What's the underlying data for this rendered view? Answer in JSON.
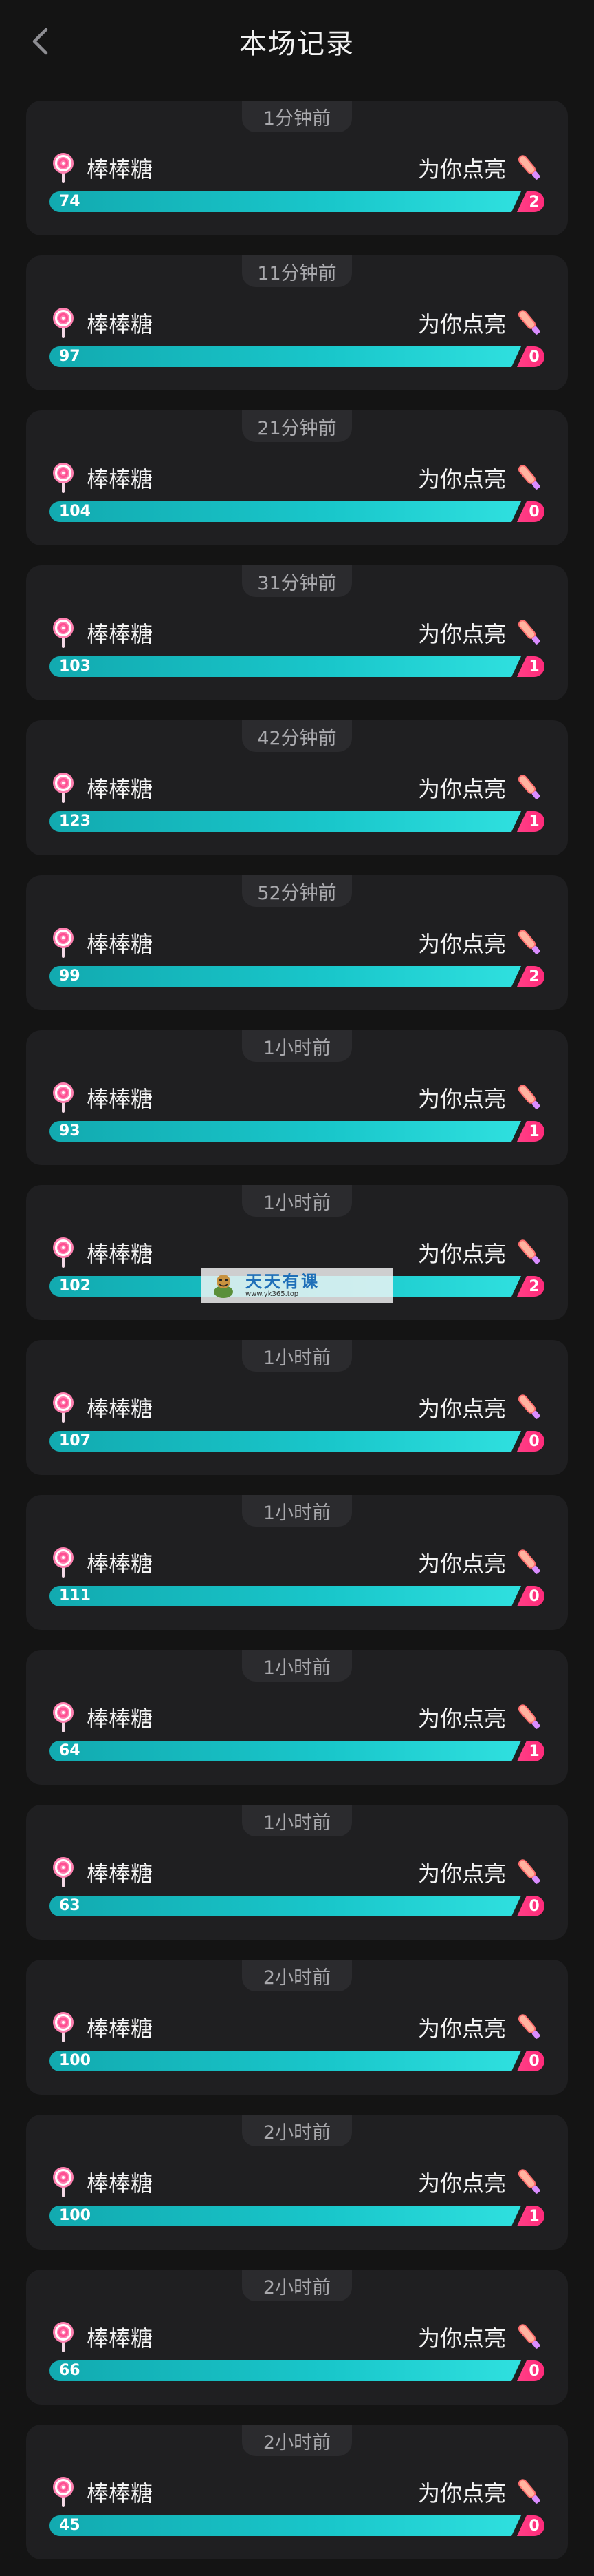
{
  "header": {
    "title": "本场记录"
  },
  "records": [
    {
      "time": "1分钟前",
      "gift": "棒棒糖",
      "cheer": "为你点亮",
      "value": "74",
      "count": "2"
    },
    {
      "time": "11分钟前",
      "gift": "棒棒糖",
      "cheer": "为你点亮",
      "value": "97",
      "count": "0"
    },
    {
      "time": "21分钟前",
      "gift": "棒棒糖",
      "cheer": "为你点亮",
      "value": "104",
      "count": "0"
    },
    {
      "time": "31分钟前",
      "gift": "棒棒糖",
      "cheer": "为你点亮",
      "value": "103",
      "count": "1"
    },
    {
      "time": "42分钟前",
      "gift": "棒棒糖",
      "cheer": "为你点亮",
      "value": "123",
      "count": "1"
    },
    {
      "time": "52分钟前",
      "gift": "棒棒糖",
      "cheer": "为你点亮",
      "value": "99",
      "count": "2"
    },
    {
      "time": "1小时前",
      "gift": "棒棒糖",
      "cheer": "为你点亮",
      "value": "93",
      "count": "1"
    },
    {
      "time": "1小时前",
      "gift": "棒棒糖",
      "cheer": "为你点亮",
      "value": "102",
      "count": "2"
    },
    {
      "time": "1小时前",
      "gift": "棒棒糖",
      "cheer": "为你点亮",
      "value": "107",
      "count": "0"
    },
    {
      "time": "1小时前",
      "gift": "棒棒糖",
      "cheer": "为你点亮",
      "value": "111",
      "count": "0"
    },
    {
      "time": "1小时前",
      "gift": "棒棒糖",
      "cheer": "为你点亮",
      "value": "64",
      "count": "1"
    },
    {
      "time": "1小时前",
      "gift": "棒棒糖",
      "cheer": "为你点亮",
      "value": "63",
      "count": "0"
    },
    {
      "time": "2小时前",
      "gift": "棒棒糖",
      "cheer": "为你点亮",
      "value": "100",
      "count": "0"
    },
    {
      "time": "2小时前",
      "gift": "棒棒糖",
      "cheer": "为你点亮",
      "value": "100",
      "count": "1"
    },
    {
      "time": "2小时前",
      "gift": "棒棒糖",
      "cheer": "为你点亮",
      "value": "66",
      "count": "0"
    },
    {
      "time": "2小时前",
      "gift": "棒棒糖",
      "cheer": "为你点亮",
      "value": "45",
      "count": "0"
    }
  ],
  "watermark": {
    "main": "天天有课",
    "sub": "www.yk365.top"
  },
  "colors": {
    "bar": "#19c7cb",
    "badge": "#ff2a7a",
    "card": "#1f1f21",
    "background": "#141414"
  },
  "icons": {
    "back": "chevron-left-icon",
    "gift": "lollipop-icon",
    "cheer": "glow-stick-icon"
  }
}
